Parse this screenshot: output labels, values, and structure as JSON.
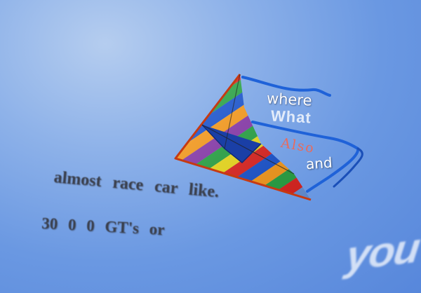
{
  "photo": {
    "sky_colors": [
      "#b5cdef",
      "#8eb2e9",
      "#6a98e2",
      "#5787db"
    ],
    "kite_stripe_colors": [
      "#ff9f1c",
      "#e52521",
      "#29a845",
      "#1a56d6",
      "#f3e21d",
      "#8c3ab0"
    ],
    "kite_frame_color": "#c63a12",
    "tail_color": "#1f62d8",
    "rope_color": "#2a4a9a"
  },
  "kite_words": {
    "where": "where",
    "what": "What",
    "also": "Also",
    "and": "and"
  },
  "caption": {
    "line1": "almost race car like.",
    "line2": "30 0 0 GT's or"
  },
  "corner_word": "you"
}
